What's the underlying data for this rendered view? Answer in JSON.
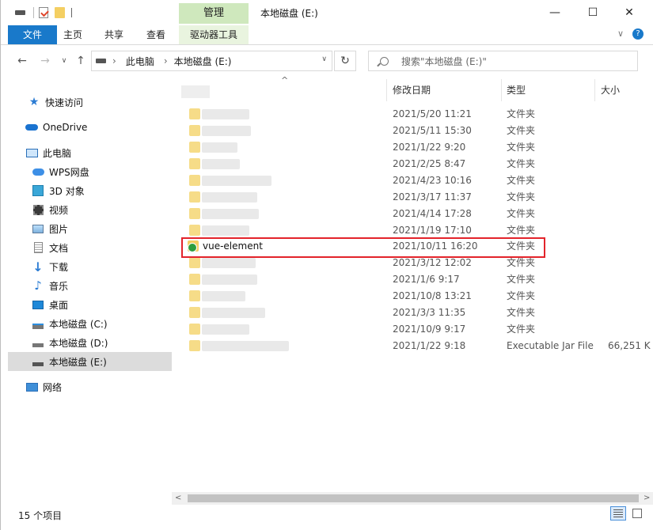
{
  "window": {
    "title": "本地磁盘 (E:)",
    "context_tab": "管理",
    "minimize": "—",
    "maximize": "☐",
    "close": "✕"
  },
  "ribbon": {
    "tabs": [
      "文件",
      "主页",
      "共享",
      "查看",
      "驱动器工具"
    ],
    "collapse_icon": "chevron-down-icon",
    "help": "?"
  },
  "nav": {
    "back": "←",
    "forward": "→",
    "recent": "∨",
    "up": "↑",
    "breadcrumb": [
      "此电脑",
      "本地磁盘 (E:)"
    ],
    "dropdown": "∨",
    "refresh": "↻",
    "search_placeholder": "搜索\"本地磁盘 (E:)\""
  },
  "sidebar": {
    "items": [
      {
        "label": "快速访问",
        "icon": "star-icon"
      },
      {
        "label": "OneDrive",
        "icon": "cloud-icon"
      },
      {
        "label": "此电脑",
        "icon": "computer-icon"
      },
      {
        "label": "WPS网盘",
        "icon": "cloud-icon"
      },
      {
        "label": "3D 对象",
        "icon": "cube-icon"
      },
      {
        "label": "视频",
        "icon": "video-icon"
      },
      {
        "label": "图片",
        "icon": "image-icon"
      },
      {
        "label": "文档",
        "icon": "document-icon"
      },
      {
        "label": "下载",
        "icon": "download-icon"
      },
      {
        "label": "音乐",
        "icon": "music-icon"
      },
      {
        "label": "桌面",
        "icon": "desktop-icon"
      },
      {
        "label": "本地磁盘 (C:)",
        "icon": "drive-icon"
      },
      {
        "label": "本地磁盘 (D:)",
        "icon": "drive-icon"
      },
      {
        "label": "本地磁盘 (E:)",
        "icon": "drive-icon"
      },
      {
        "label": "网络",
        "icon": "network-icon"
      }
    ]
  },
  "columns": {
    "date": "修改日期",
    "type": "类型",
    "size": "大小",
    "sort_indicator": "^"
  },
  "files": [
    {
      "name": "",
      "date": "2021/5/20 11:21",
      "type": "文件夹",
      "size": ""
    },
    {
      "name": "",
      "date": "2021/5/11 15:30",
      "type": "文件夹",
      "size": ""
    },
    {
      "name": "",
      "date": "2021/1/22 9:20",
      "type": "文件夹",
      "size": ""
    },
    {
      "name": "",
      "date": "2021/2/25 8:47",
      "type": "文件夹",
      "size": ""
    },
    {
      "name": "",
      "date": "2021/4/23 10:16",
      "type": "文件夹",
      "size": ""
    },
    {
      "name": "",
      "date": "2021/3/17 11:37",
      "type": "文件夹",
      "size": ""
    },
    {
      "name": "",
      "date": "2021/4/14 17:28",
      "type": "文件夹",
      "size": ""
    },
    {
      "name": "",
      "date": "2021/1/19 17:10",
      "type": "文件夹",
      "size": ""
    },
    {
      "name": "vue-element",
      "date": "2021/10/11 16:20",
      "type": "文件夹",
      "size": ""
    },
    {
      "name": "",
      "date": "2021/3/12 12:02",
      "type": "文件夹",
      "size": ""
    },
    {
      "name": "",
      "date": "2021/1/6 9:17",
      "type": "文件夹",
      "size": ""
    },
    {
      "name": "",
      "date": "2021/10/8 13:21",
      "type": "文件夹",
      "size": ""
    },
    {
      "name": "",
      "date": "2021/3/3 11:35",
      "type": "文件夹",
      "size": ""
    },
    {
      "name": "",
      "date": "2021/10/9 9:17",
      "type": "文件夹",
      "size": ""
    },
    {
      "name": "",
      "date": "2021/1/22 9:18",
      "type": "Executable Jar File",
      "size": "66,251 K"
    }
  ],
  "status": {
    "count": "15 个项目"
  },
  "colors": {
    "file_tab": "#1979ca",
    "context_tab": "#cfe8bd",
    "highlight_border": "#e3242b",
    "selected_item": "#dcdcdc"
  }
}
